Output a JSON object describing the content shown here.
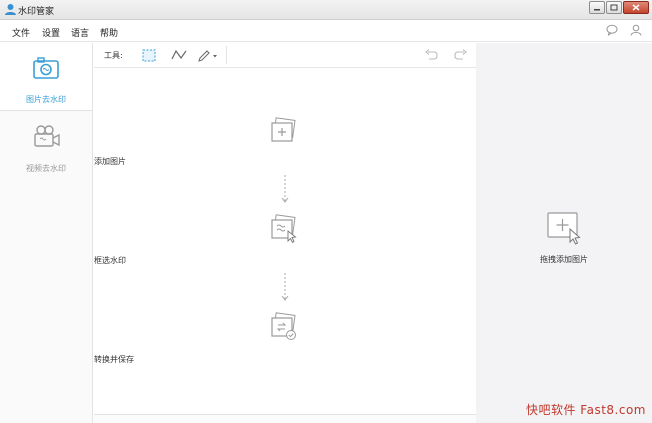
{
  "window": {
    "title": "水印管家"
  },
  "menu": {
    "items": [
      "文件",
      "设置",
      "语言",
      "帮助"
    ]
  },
  "modes": [
    {
      "label": "图片去水印",
      "active": true
    },
    {
      "label": "视频去水印",
      "active": false
    }
  ],
  "toolbar": {
    "label": "工具:"
  },
  "steps": [
    {
      "label": "添加图片"
    },
    {
      "label": "框选水印"
    },
    {
      "label": "转换并保存"
    }
  ],
  "right_panel": {
    "drop_label": "拖拽添加图片"
  },
  "watermark": {
    "text": "快吧软件 Fast8.com"
  },
  "colors": {
    "accent": "#3a9fd6",
    "icon_gray": "#9a9a9a",
    "panel_bg": "#f3f3f5"
  }
}
